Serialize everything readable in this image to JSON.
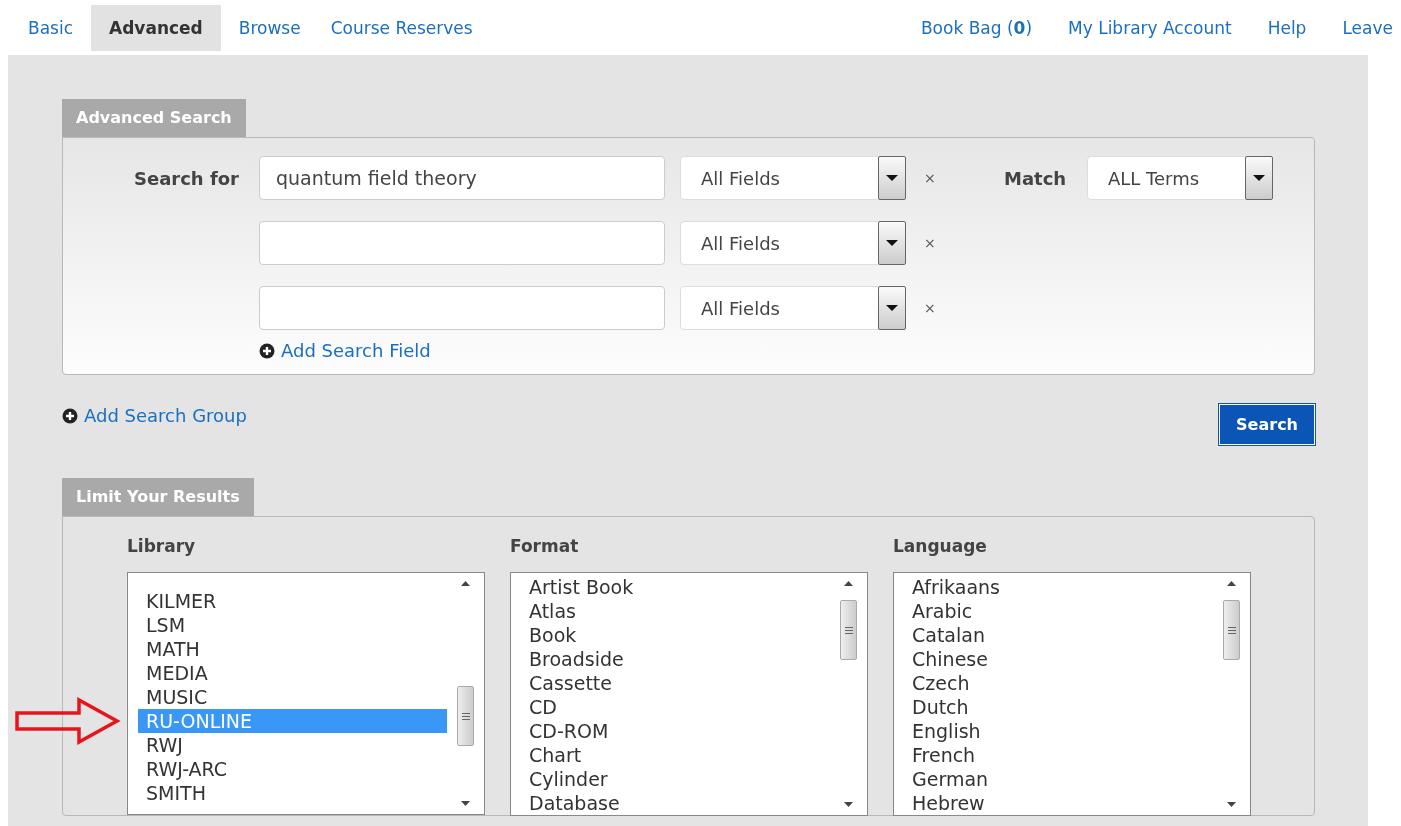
{
  "nav": {
    "left": [
      {
        "label": "Basic",
        "selected": false
      },
      {
        "label": "Advanced",
        "selected": true
      },
      {
        "label": "Browse",
        "selected": false
      },
      {
        "label": "Course Reserves",
        "selected": false
      }
    ],
    "right": [
      "Book Bag (**0**)",
      "My Library Account",
      "Help",
      "Leave"
    ]
  },
  "search": {
    "title": "Advanced Search",
    "label": "Search for",
    "rows": [
      {
        "value": "quantum field theory",
        "field": "All Fields",
        "remove": "×"
      },
      {
        "value": "",
        "field": "All Fields",
        "remove": "×"
      },
      {
        "value": "",
        "field": "All Fields",
        "remove": "×"
      }
    ],
    "add_field": "Add Search Field",
    "match_label": "Match",
    "match": "ALL Terms"
  },
  "add_group": "Add Search Group",
  "search_button": "Search",
  "limit": {
    "title": "Limit Your Results",
    "lists": [
      {
        "title": "Library",
        "items": [
          {
            "label": "KILMER",
            "selected": false
          },
          {
            "label": "LSM",
            "selected": false
          },
          {
            "label": "MATH",
            "selected": false
          },
          {
            "label": "MEDIA",
            "selected": false
          },
          {
            "label": "MUSIC",
            "selected": false
          },
          {
            "label": "RU-ONLINE",
            "selected": true
          },
          {
            "label": "RWJ",
            "selected": false
          },
          {
            "label": "RWJ-ARC",
            "selected": false
          },
          {
            "label": "SMITH",
            "selected": false
          }
        ]
      },
      {
        "title": "Format",
        "items": [
          {
            "label": "Artist Book",
            "selected": false
          },
          {
            "label": "Atlas",
            "selected": false
          },
          {
            "label": "Book",
            "selected": false
          },
          {
            "label": "Broadside",
            "selected": false
          },
          {
            "label": "Cassette",
            "selected": false
          },
          {
            "label": "CD",
            "selected": false
          },
          {
            "label": "CD-ROM",
            "selected": false
          },
          {
            "label": "Chart",
            "selected": false
          },
          {
            "label": "Cylinder",
            "selected": false
          },
          {
            "label": "Database",
            "selected": false
          }
        ]
      },
      {
        "title": "Language",
        "items": [
          {
            "label": "Afrikaans",
            "selected": false
          },
          {
            "label": "Arabic",
            "selected": false
          },
          {
            "label": "Catalan",
            "selected": false
          },
          {
            "label": "Chinese",
            "selected": false
          },
          {
            "label": "Czech",
            "selected": false
          },
          {
            "label": "Dutch",
            "selected": false
          },
          {
            "label": "English",
            "selected": false
          },
          {
            "label": "French",
            "selected": false
          },
          {
            "label": "German",
            "selected": false
          },
          {
            "label": "Hebrew",
            "selected": false
          }
        ]
      }
    ]
  }
}
